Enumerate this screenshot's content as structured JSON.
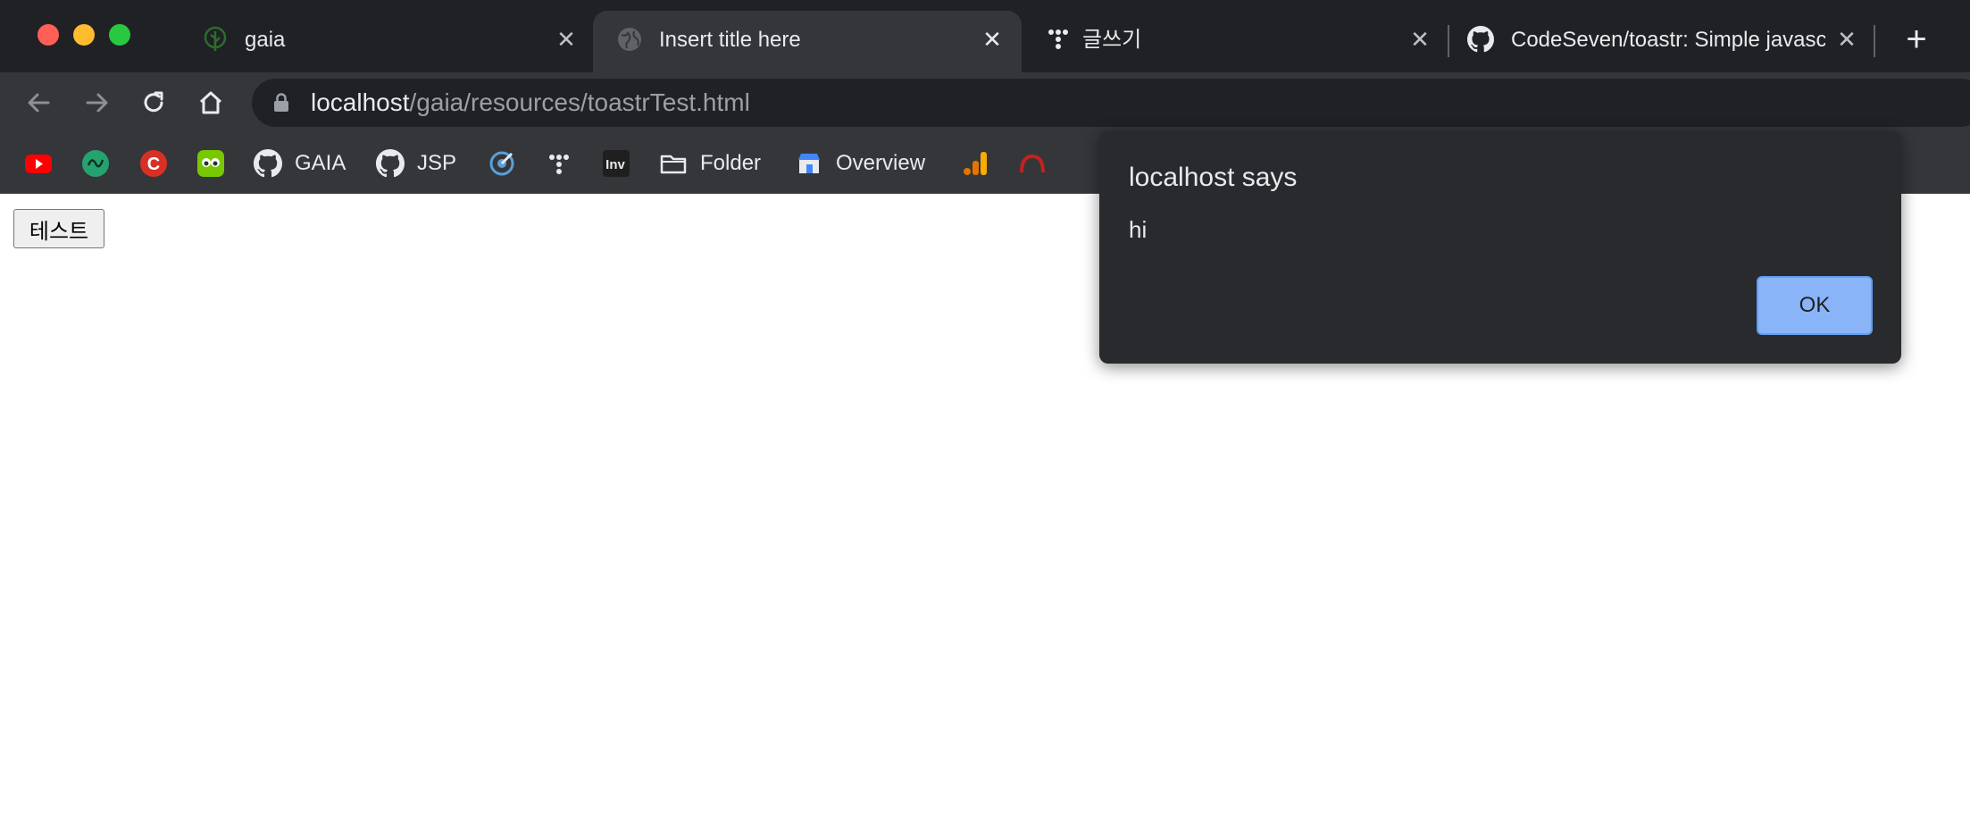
{
  "window": {
    "controls": [
      "close",
      "minimize",
      "maximize"
    ]
  },
  "tabs": [
    {
      "title": "gaia",
      "favicon": "tree-icon",
      "active": false
    },
    {
      "title": "Insert title here",
      "favicon": "globe-icon",
      "active": true
    },
    {
      "title": "글쓰기",
      "favicon": "tistory-icon",
      "active": false
    },
    {
      "title": "CodeSeven/toastr: Simple javascript toast notifications",
      "favicon": "github-icon",
      "active": false
    }
  ],
  "toolbar": {
    "url_host": "localhost",
    "url_path": "/gaia/resources/toastrTest.html"
  },
  "bookmarks": [
    {
      "label": "",
      "icon": "youtube-icon"
    },
    {
      "label": "",
      "icon": "green-logo-icon"
    },
    {
      "label": "",
      "icon": "red-c-icon"
    },
    {
      "label": "",
      "icon": "duolingo-icon"
    },
    {
      "label": "GAIA",
      "icon": "github-icon"
    },
    {
      "label": "JSP",
      "icon": "github-icon"
    },
    {
      "label": "",
      "icon": "target-icon"
    },
    {
      "label": "",
      "icon": "tistory-icon"
    },
    {
      "label": "",
      "icon": "inv-icon"
    },
    {
      "label": "Folder",
      "icon": "folder-icon"
    },
    {
      "label": "Overview",
      "icon": "store-icon"
    },
    {
      "label": "",
      "icon": "analytics-icon"
    },
    {
      "label": "",
      "icon": "red-arc-icon"
    }
  ],
  "page": {
    "test_button_label": "테스트"
  },
  "dialog": {
    "title": "localhost says",
    "message": "hi",
    "ok_label": "OK"
  },
  "colors": {
    "tabstrip_bg": "#202124",
    "toolbar_bg": "#35363a",
    "dialog_bg": "#292a2d",
    "ok_button": "#8ab4f8"
  }
}
